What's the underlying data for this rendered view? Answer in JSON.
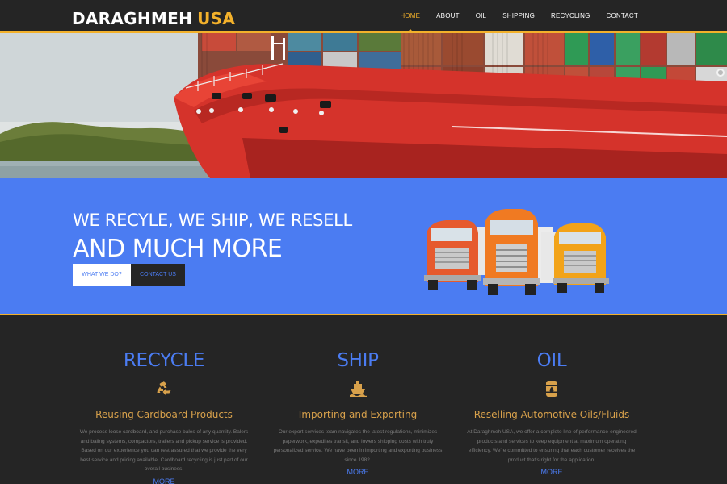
{
  "header": {
    "logo_main": "DARAGHMEH",
    "logo_accent": "USA",
    "nav": [
      "HOME",
      "ABOUT",
      "OIL",
      "SHIPPING",
      "RECYCLING",
      "CONTACT"
    ],
    "active": "HOME"
  },
  "colors": {
    "accent": "#f3b12b",
    "blue": "#4b7cf2",
    "dark": "#252525"
  },
  "banner": {
    "line1": "WE RECYLE, WE SHIP, WE RESELL",
    "line2": "AND MUCH MORE",
    "btn_what": "WHAT WE DO?",
    "btn_contact": "CONTACT US"
  },
  "services": [
    {
      "title": "RECYCLE",
      "icon": "recycle-icon",
      "subtitle": "Reusing Cardboard Products",
      "desc": "We process loose cardboard, and purchase bales of any quantity. Balers and baling systems, compactors, trailers and pickup service is provided. Based on our experience you can rest assured that we provide the very best service and pricing available. Cardboard recycling is just part of our overall business.",
      "more": "MORE"
    },
    {
      "title": "SHIP",
      "icon": "ship-icon",
      "subtitle": "Importing and Exporting",
      "desc": "Our export services team navigates the latest regulations, minimizes paperwork, expedites transit, and lowers shipping costs with truly personalized service. We have been in importing and exporting business since 1982.",
      "more": "MORE"
    },
    {
      "title": "OIL",
      "icon": "oil-barrel-icon",
      "subtitle": "Reselling Automotive Oils/Fluids",
      "desc": "At Daraghmeh USA, we offer a complete line of performance-engineered products and services to keep equipment at maximum operating efficiency. We're committed to ensuring that each customer receives the product that's right for the application.",
      "more": "MORE"
    }
  ]
}
